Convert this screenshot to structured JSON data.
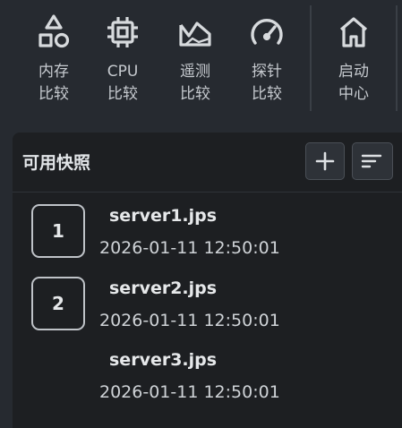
{
  "toolbar": {
    "items": [
      {
        "icon": "shapes-icon",
        "line1": "内存",
        "line2": "比较"
      },
      {
        "icon": "cpu-chip-icon",
        "line1": "CPU",
        "line2": "比较"
      },
      {
        "icon": "area-chart-icon",
        "line1": "遥测",
        "line2": "比较"
      },
      {
        "icon": "gauge-icon",
        "line1": "探针",
        "line2": "比较"
      },
      {
        "icon": "home-icon",
        "line1": "启动",
        "line2": "中心"
      }
    ]
  },
  "panel": {
    "title": "可用快照",
    "add_icon": "plus-icon",
    "sort_icon": "sort-lines-icon"
  },
  "snapshots": [
    {
      "badge": "1",
      "name": "server1.jps",
      "time": "2026-01-11 12:50:01"
    },
    {
      "badge": "2",
      "name": "server2.jps",
      "time": "2026-01-11 12:50:01"
    },
    {
      "badge": "",
      "name": "server3.jps",
      "time": "2026-01-11 12:50:01"
    }
  ]
}
